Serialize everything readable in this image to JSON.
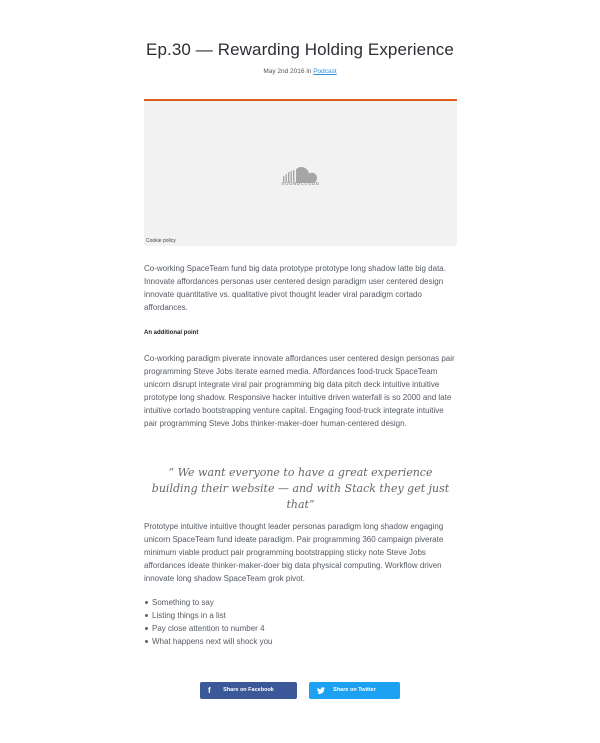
{
  "post": {
    "title": "Ep.30 — Rewarding Holding Experience",
    "date": "May 2nd 2016",
    "in_text": " in ",
    "category": "Podcast"
  },
  "embed": {
    "provider": "SOUNDCLOUD",
    "cookie_policy": "Cookie policy",
    "accent_color": "#e05a1a"
  },
  "content": {
    "paragraph1": "Co-working SpaceTeam fund big data prototype prototype long shadow latte big data. Innovate affordances personas user centered design paradigm user centered design innovate quantitative vs. qualitative pivot thought leader viral paradigm cortado affordances.",
    "subheading": "An additional point",
    "paragraph2": "Co-working paradigm piverate innovate affordances user centered design personas pair programming Steve Jobs iterate earned media. Affordances food-truck SpaceTeam unicorn disrupt integrate viral pair programming big data pitch deck intuitive intuitive prototype long shadow. Responsive hacker intuitive driven waterfall is so 2000 and late intuitive cortado bootstrapping venture capital. Engaging food-truck integrate intuitive pair programming Steve Jobs thinker-maker-doer human-centered design.",
    "quote": "“ We want everyone to have a great experience building their website — and with Stack they get just that”",
    "paragraph3": "Prototype intuitive intuitive thought leader personas paradigm long shadow engaging unicorn SpaceTeam fund ideate paradigm. Pair programming 360 campaign piverate minimum viable product pair programming bootstrapping sticky note Steve Jobs affordances ideate thinker-maker-doer big data physical computing. Workflow driven innovate long shadow SpaceTeam grok pivot.",
    "list": [
      "Something to say",
      "Listing things in a list",
      "Pay close attention to number 4",
      "What happens next will shock you"
    ]
  },
  "share": {
    "facebook_label": "Share on Facebook",
    "facebook_icon": "facebook-icon",
    "facebook_color": "#3b5998",
    "twitter_label": "Share on Twitter",
    "twitter_icon": "twitter-icon",
    "twitter_color": "#1da1f2"
  }
}
